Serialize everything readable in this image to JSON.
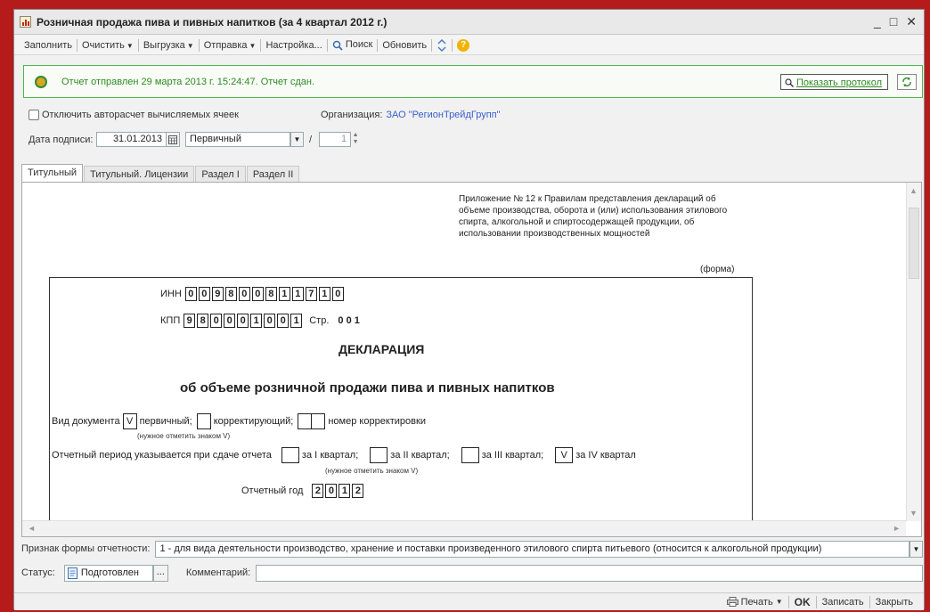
{
  "window": {
    "title": "Розничная продажа пива и пивных напитков (за 4 квартал 2012 г.)",
    "controls": [
      "_",
      "□",
      "✕"
    ]
  },
  "toolbar": {
    "fill": "Заполнить",
    "clear": "Очистить",
    "export": "Выгрузка",
    "send": "Отправка",
    "settings": "Настройка...",
    "search": "Поиск",
    "refresh": "Обновить",
    "help": "?"
  },
  "status_panel": {
    "message": "Отчет отправлен 29 марта 2013 г. 15:24:47. Отчет сдан.",
    "show_protocol": "Показать протокол"
  },
  "options": {
    "auto_calc": "Отключить авторасчет вычисляемых ячеек",
    "org_label": "Организация:",
    "org_value": "ЗАО \"РегионТрейдГрупп\"",
    "sign_date_label": "Дата подписи:",
    "sign_date": "31.01.2013",
    "doc_kind": "Первичный",
    "slash": "/",
    "correction_no": "1"
  },
  "tabs": [
    "Титульный",
    "Титульный. Лицензии",
    "Раздел I",
    "Раздел II"
  ],
  "document": {
    "appendix": "Приложение № 12 к Правилам представления деклараций об объеме производства, оборота и (или) использования этилового спирта, алкогольной и спиртосодержащей продукции, об использовании производственных мощностей",
    "forma": "(форма)",
    "inn_label": "ИНН",
    "inn": [
      "0",
      "0",
      "9",
      "8",
      "0",
      "0",
      "8",
      "1",
      "1",
      "7",
      "1",
      "0"
    ],
    "kpp_label": "КПП",
    "kpp": [
      "9",
      "8",
      "0",
      "0",
      "0",
      "1",
      "0",
      "0",
      "1"
    ],
    "page_label": "Стр.",
    "page": "0 0 1",
    "title": "ДЕКЛАРАЦИЯ",
    "subtitle": "об объеме розничной продажи пива и пивных напитков",
    "doc_type_label": "Вид документа",
    "doc_type_mark": "V",
    "primary": "первичный;",
    "corrective": "корректирующий;",
    "correction_number": "номер корректировки",
    "note_v": "(нужное отметить знаком V)",
    "period_label": "Отчетный период указывается при сдаче отчета",
    "q1": "за I квартал;",
    "q2": "за II квартал;",
    "q3": "за III квартал;",
    "q4": "за IV квартал",
    "q4_mark": "V",
    "note_v2": "(нужное отметить знаком V)",
    "year_label": "Отчетный год",
    "year": [
      "2",
      "0",
      "1",
      "2"
    ]
  },
  "form_sign": {
    "label": "Признак формы отчетности:",
    "value": "1 - для вида деятельности производство, хранение и поставки произведенного этилового спирта питьевого (относится к алкогольной продукции)"
  },
  "status": {
    "label": "Статус:",
    "value": "Подготовлен",
    "more": "...",
    "comment_label": "Комментарий:"
  },
  "footer": {
    "print": "Печать",
    "ok": "OK",
    "save": "Записать",
    "close": "Закрыть"
  }
}
